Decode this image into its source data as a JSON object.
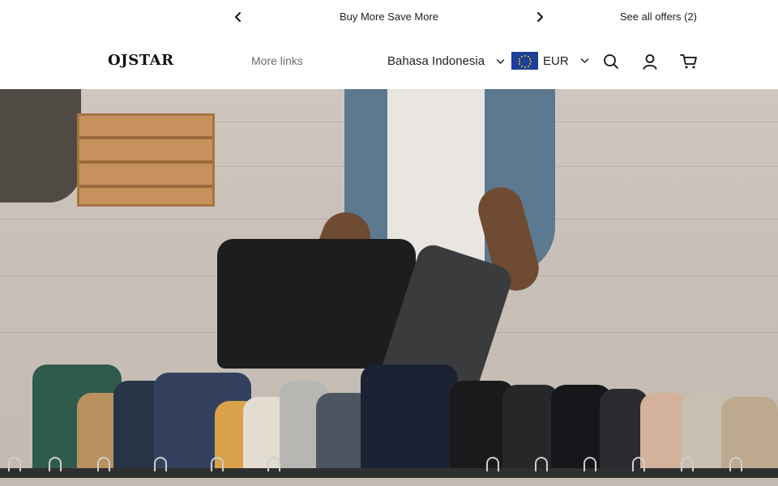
{
  "announcement": {
    "message": "Buy More Save More",
    "offers_link": "See all offers (2)"
  },
  "header": {
    "logo": "OJSTAR",
    "more_links": "More links",
    "language": "Bahasa Indonesia",
    "currency": "EUR"
  },
  "icons": {
    "prev": "chevron-left-icon",
    "next": "chevron-right-icon",
    "language_dropdown": "chevron-down-icon",
    "currency_dropdown": "chevron-down-icon",
    "flag": "eu-flag-icon",
    "search": "search-icon",
    "account": "user-icon",
    "cart": "cart-icon"
  },
  "colors": {
    "flag_blue": "#1b3f9a",
    "flag_star": "#f7d000",
    "text": "#1f1f1f",
    "muted": "#6b6b6b"
  }
}
